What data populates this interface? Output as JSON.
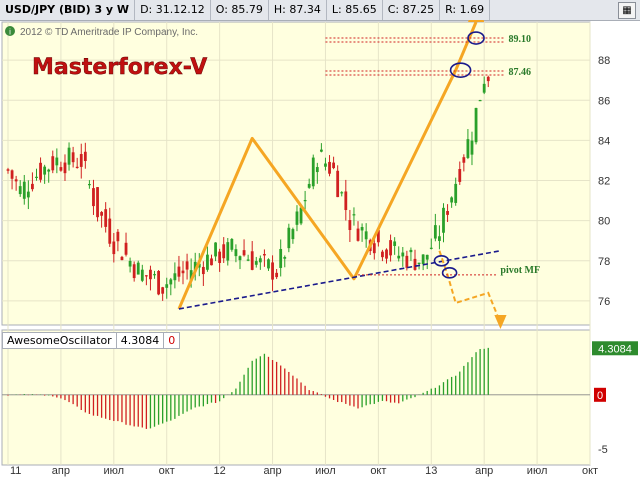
{
  "header": {
    "symbol": "USD/JPY (BID) 3 y W",
    "date": "D: 31.12.12",
    "open": "O: 85.79",
    "high": "H: 87.34",
    "low": "L: 85.65",
    "close": "C: 87.25",
    "range": "R: 1.69"
  },
  "copyright": "2012 © TD Ameritrade IP Company, Inc.",
  "watermark": "Masterforex-V",
  "indicator": {
    "name": "AwesomeOscillator",
    "value": "4.3084",
    "zero": "0"
  },
  "colors": {
    "bull": "#2aa02a",
    "bear": "#d02020",
    "pattern": "#f5a623",
    "trend": "#1a1a8c",
    "level": "#d02020",
    "osc_badge": "#2e8b2e"
  },
  "chart_data": {
    "type": "candlestick",
    "instrument": "USD/JPY",
    "timeframe": "W",
    "x_tick_labels": [
      "11",
      "апр",
      "июл",
      "окт",
      "12",
      "апр",
      "июл",
      "окт",
      "13",
      "апр",
      "июл",
      "окт"
    ],
    "y_tick_labels": [
      "76",
      "78",
      "80",
      "82",
      "84",
      "86",
      "88"
    ],
    "ylim": [
      74.8,
      89.9
    ],
    "annotations": [
      {
        "label": "89.10",
        "price": 89.1
      },
      {
        "label": "87.46",
        "price": 87.46
      },
      {
        "label": "pivot MF",
        "price": 77.3
      }
    ],
    "oscillator": {
      "name": "AwesomeOscillator",
      "last": 4.3084,
      "y_tick_labels": [
        "-5",
        "0",
        "4.3084"
      ],
      "ylim": [
        -6.5,
        6.0
      ]
    }
  }
}
